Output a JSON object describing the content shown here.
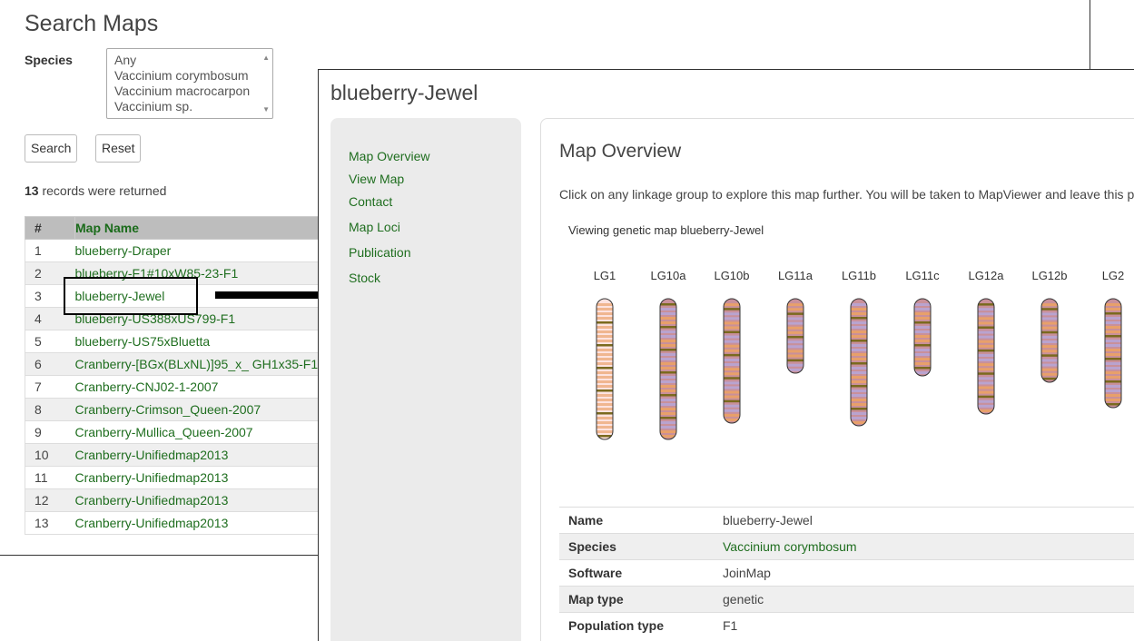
{
  "search_page": {
    "title": "Search Maps",
    "species_label": "Species",
    "species_options": [
      "Any",
      "Vaccinium corymbosum",
      "Vaccinium macrocarpon",
      "Vaccinium sp."
    ],
    "search_button": "Search",
    "reset_button": "Reset",
    "records_count": "13",
    "records_text": " records were returned",
    "table": {
      "headers": [
        "#",
        "Map Name"
      ],
      "rows": [
        {
          "num": "1",
          "name": "blueberry-Draper"
        },
        {
          "num": "2",
          "name": "blueberry-F1#10xW85-23-F1"
        },
        {
          "num": "3",
          "name": "blueberry-Jewel"
        },
        {
          "num": "4",
          "name": "blueberry-US388xUS799-F1"
        },
        {
          "num": "5",
          "name": "blueberry-US75xBluetta"
        },
        {
          "num": "6",
          "name": "Cranberry-[BGx(BLxNL)]95_x_ GH1x35-F1"
        },
        {
          "num": "7",
          "name": "Cranberry-CNJ02-1-2007"
        },
        {
          "num": "8",
          "name": "Cranberry-Crimson_Queen-2007"
        },
        {
          "num": "9",
          "name": "Cranberry-Mullica_Queen-2007"
        },
        {
          "num": "10",
          "name": "Cranberry-Unifiedmap2013"
        },
        {
          "num": "11",
          "name": "Cranberry-Unifiedmap2013"
        },
        {
          "num": "12",
          "name": "Cranberry-Unifiedmap2013"
        },
        {
          "num": "13",
          "name": "Cranberry-Unifiedmap2013"
        }
      ]
    }
  },
  "map_page": {
    "title": "blueberry-Jewel",
    "nav": [
      "Map Overview",
      "View Map",
      "Contact",
      "Map Loci",
      "Publication",
      "Stock"
    ],
    "section_title": "Map Overview",
    "description": "Click on any linkage group to explore this map further. You will be taken to MapViewer and leave this pa",
    "viewing_text": "Viewing genetic map blueberry-Jewel",
    "linkage_groups": [
      "LG1",
      "LG10a",
      "LG10b",
      "LG11a",
      "LG11b",
      "LG11c",
      "LG12a",
      "LG12b",
      "LG2"
    ],
    "details": [
      {
        "key": "Name",
        "value": "blueberry-Jewel"
      },
      {
        "key": "Species",
        "value": "Vaccinium corymbosum"
      },
      {
        "key": "Software",
        "value": "JoinMap"
      },
      {
        "key": "Map type",
        "value": "genetic"
      },
      {
        "key": "Population type",
        "value": "F1"
      }
    ]
  },
  "colors": {
    "link_green": "#1f6e1f",
    "chromosome_fill": "#c9909a",
    "band_orange": "#e8a06a",
    "band_olive": "#7a6a1e",
    "band_lavender": "#b9a3cf"
  }
}
